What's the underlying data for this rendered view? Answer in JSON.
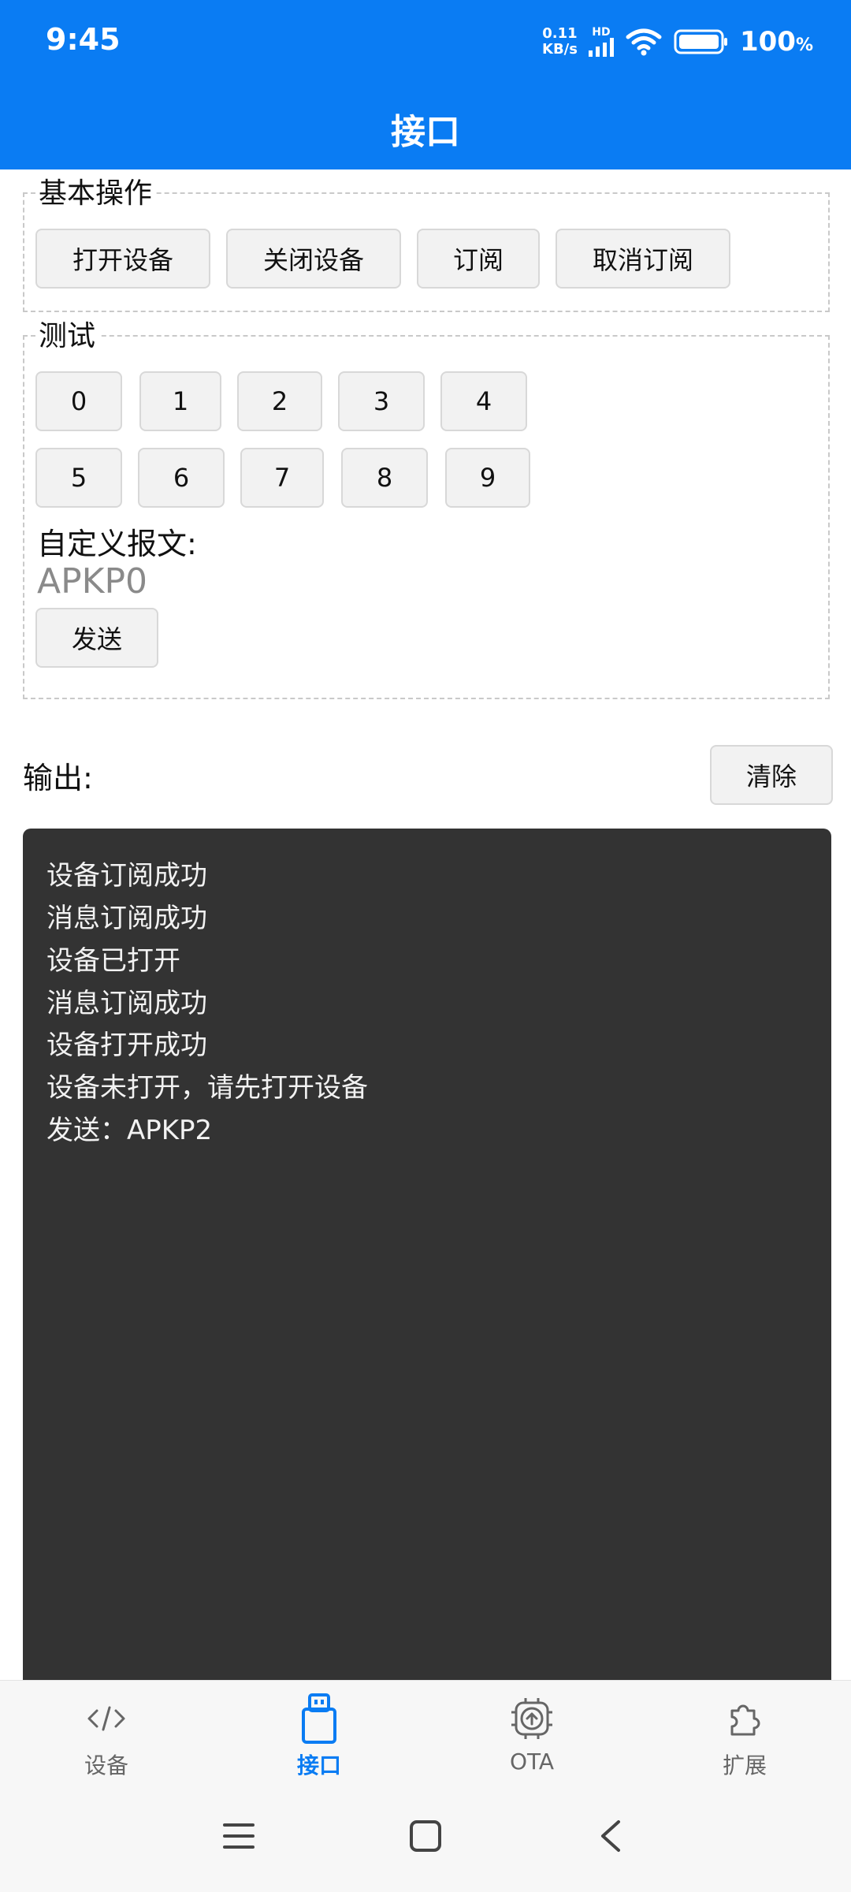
{
  "status_bar": {
    "time": "9:45",
    "net_speed_value": "0.11",
    "net_speed_unit": "KB/s",
    "hd_label": "HD",
    "battery_level": "100",
    "battery_unit": "%"
  },
  "app_bar": {
    "title": "接口"
  },
  "basic_ops": {
    "legend": "基本操作",
    "buttons": [
      "打开设备",
      "关闭设备",
      "订阅",
      "取消订阅"
    ]
  },
  "test": {
    "legend": "测试",
    "number_buttons": [
      "0",
      "1",
      "2",
      "3",
      "4",
      "5",
      "6",
      "7",
      "8",
      "9"
    ],
    "custom_label": "自定义报文:",
    "custom_value": "APKP0",
    "send_label": "发送"
  },
  "output": {
    "label": "输出:",
    "clear_label": "清除",
    "lines": [
      "设备订阅成功",
      "消息订阅成功",
      "设备已打开",
      "消息订阅成功",
      "设备打开成功",
      "设备未打开，请先打开设备",
      "发送：APKP2"
    ]
  },
  "bottom_nav": {
    "items": [
      {
        "label": "设备",
        "icon": "code-icon"
      },
      {
        "label": "接口",
        "icon": "usb-icon",
        "active": true
      },
      {
        "label": "OTA",
        "icon": "chip-upload-icon"
      },
      {
        "label": "扩展",
        "icon": "puzzle-icon"
      }
    ]
  },
  "system_nav": {
    "icons": [
      "menu-icon",
      "home-square-icon",
      "back-chevron-icon"
    ]
  },
  "colors": {
    "primary": "#0a7cf3",
    "output_bg": "#333333",
    "button_bg": "#f2f2f2"
  }
}
